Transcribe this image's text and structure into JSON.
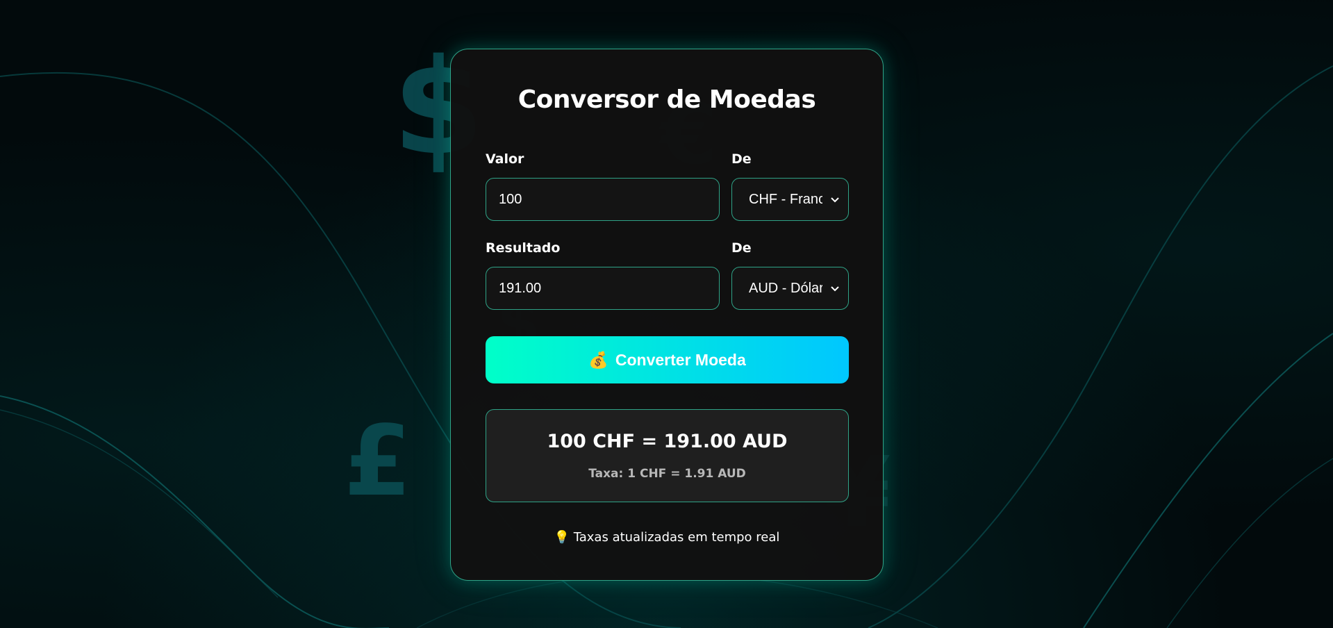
{
  "app": {
    "title": "Conversor de Moedas"
  },
  "form": {
    "amount": {
      "label": "Valor",
      "value": "100"
    },
    "from_currency": {
      "label": "De",
      "selected": "CHF - Franco Suíço"
    },
    "result": {
      "label": "Resultado",
      "value": "191.00"
    },
    "to_currency": {
      "label": "De",
      "selected": "AUD - Dólar Australiano"
    }
  },
  "button": {
    "icon": "money-bag-icon",
    "emoji": "💰",
    "label": "Converter Moeda"
  },
  "result_box": {
    "summary": "100 CHF = 191.00 AUD",
    "rate": "Taxa: 1 CHF = 1.91 AUD"
  },
  "footer": {
    "icon": "light-bulb-icon",
    "emoji": "💡",
    "text": "Taxas atualizadas em tempo real"
  },
  "background": {
    "symbols": [
      "$",
      "€",
      "£",
      "¥",
      "$"
    ]
  },
  "colors": {
    "accent_border": "#2fa387",
    "button_gradient_start": "#00ffc8",
    "button_gradient_end": "#00c7ff",
    "card_bg": "#111111",
    "page_bg": "#02080a"
  }
}
